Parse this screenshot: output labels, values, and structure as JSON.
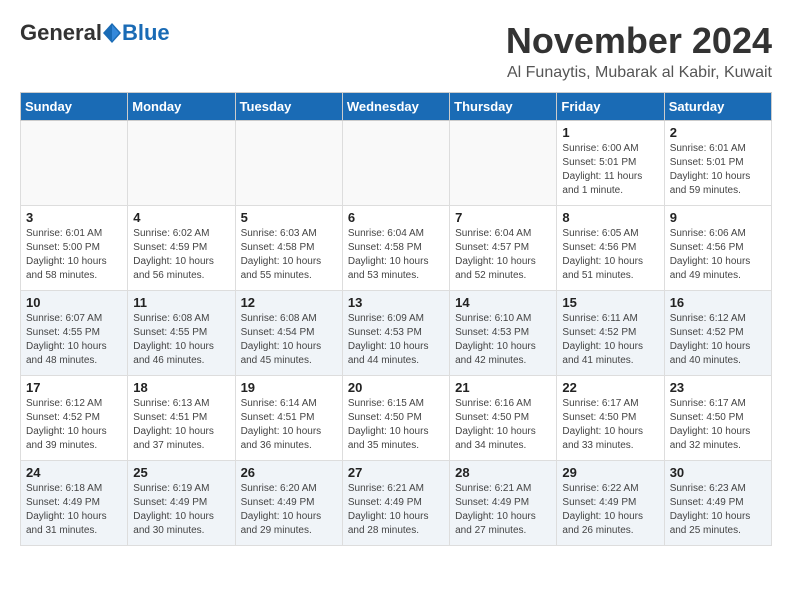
{
  "header": {
    "logo_general": "General",
    "logo_blue": "Blue",
    "month_title": "November 2024",
    "subtitle": "Al Funaytis, Mubarak al Kabir, Kuwait"
  },
  "weekdays": [
    "Sunday",
    "Monday",
    "Tuesday",
    "Wednesday",
    "Thursday",
    "Friday",
    "Saturday"
  ],
  "weeks": [
    [
      {
        "day": "",
        "info": ""
      },
      {
        "day": "",
        "info": ""
      },
      {
        "day": "",
        "info": ""
      },
      {
        "day": "",
        "info": ""
      },
      {
        "day": "",
        "info": ""
      },
      {
        "day": "1",
        "info": "Sunrise: 6:00 AM\nSunset: 5:01 PM\nDaylight: 11 hours\nand 1 minute."
      },
      {
        "day": "2",
        "info": "Sunrise: 6:01 AM\nSunset: 5:01 PM\nDaylight: 10 hours\nand 59 minutes."
      }
    ],
    [
      {
        "day": "3",
        "info": "Sunrise: 6:01 AM\nSunset: 5:00 PM\nDaylight: 10 hours\nand 58 minutes."
      },
      {
        "day": "4",
        "info": "Sunrise: 6:02 AM\nSunset: 4:59 PM\nDaylight: 10 hours\nand 56 minutes."
      },
      {
        "day": "5",
        "info": "Sunrise: 6:03 AM\nSunset: 4:58 PM\nDaylight: 10 hours\nand 55 minutes."
      },
      {
        "day": "6",
        "info": "Sunrise: 6:04 AM\nSunset: 4:58 PM\nDaylight: 10 hours\nand 53 minutes."
      },
      {
        "day": "7",
        "info": "Sunrise: 6:04 AM\nSunset: 4:57 PM\nDaylight: 10 hours\nand 52 minutes."
      },
      {
        "day": "8",
        "info": "Sunrise: 6:05 AM\nSunset: 4:56 PM\nDaylight: 10 hours\nand 51 minutes."
      },
      {
        "day": "9",
        "info": "Sunrise: 6:06 AM\nSunset: 4:56 PM\nDaylight: 10 hours\nand 49 minutes."
      }
    ],
    [
      {
        "day": "10",
        "info": "Sunrise: 6:07 AM\nSunset: 4:55 PM\nDaylight: 10 hours\nand 48 minutes."
      },
      {
        "day": "11",
        "info": "Sunrise: 6:08 AM\nSunset: 4:55 PM\nDaylight: 10 hours\nand 46 minutes."
      },
      {
        "day": "12",
        "info": "Sunrise: 6:08 AM\nSunset: 4:54 PM\nDaylight: 10 hours\nand 45 minutes."
      },
      {
        "day": "13",
        "info": "Sunrise: 6:09 AM\nSunset: 4:53 PM\nDaylight: 10 hours\nand 44 minutes."
      },
      {
        "day": "14",
        "info": "Sunrise: 6:10 AM\nSunset: 4:53 PM\nDaylight: 10 hours\nand 42 minutes."
      },
      {
        "day": "15",
        "info": "Sunrise: 6:11 AM\nSunset: 4:52 PM\nDaylight: 10 hours\nand 41 minutes."
      },
      {
        "day": "16",
        "info": "Sunrise: 6:12 AM\nSunset: 4:52 PM\nDaylight: 10 hours\nand 40 minutes."
      }
    ],
    [
      {
        "day": "17",
        "info": "Sunrise: 6:12 AM\nSunset: 4:52 PM\nDaylight: 10 hours\nand 39 minutes."
      },
      {
        "day": "18",
        "info": "Sunrise: 6:13 AM\nSunset: 4:51 PM\nDaylight: 10 hours\nand 37 minutes."
      },
      {
        "day": "19",
        "info": "Sunrise: 6:14 AM\nSunset: 4:51 PM\nDaylight: 10 hours\nand 36 minutes."
      },
      {
        "day": "20",
        "info": "Sunrise: 6:15 AM\nSunset: 4:50 PM\nDaylight: 10 hours\nand 35 minutes."
      },
      {
        "day": "21",
        "info": "Sunrise: 6:16 AM\nSunset: 4:50 PM\nDaylight: 10 hours\nand 34 minutes."
      },
      {
        "day": "22",
        "info": "Sunrise: 6:17 AM\nSunset: 4:50 PM\nDaylight: 10 hours\nand 33 minutes."
      },
      {
        "day": "23",
        "info": "Sunrise: 6:17 AM\nSunset: 4:50 PM\nDaylight: 10 hours\nand 32 minutes."
      }
    ],
    [
      {
        "day": "24",
        "info": "Sunrise: 6:18 AM\nSunset: 4:49 PM\nDaylight: 10 hours\nand 31 minutes."
      },
      {
        "day": "25",
        "info": "Sunrise: 6:19 AM\nSunset: 4:49 PM\nDaylight: 10 hours\nand 30 minutes."
      },
      {
        "day": "26",
        "info": "Sunrise: 6:20 AM\nSunset: 4:49 PM\nDaylight: 10 hours\nand 29 minutes."
      },
      {
        "day": "27",
        "info": "Sunrise: 6:21 AM\nSunset: 4:49 PM\nDaylight: 10 hours\nand 28 minutes."
      },
      {
        "day": "28",
        "info": "Sunrise: 6:21 AM\nSunset: 4:49 PM\nDaylight: 10 hours\nand 27 minutes."
      },
      {
        "day": "29",
        "info": "Sunrise: 6:22 AM\nSunset: 4:49 PM\nDaylight: 10 hours\nand 26 minutes."
      },
      {
        "day": "30",
        "info": "Sunrise: 6:23 AM\nSunset: 4:49 PM\nDaylight: 10 hours\nand 25 minutes."
      }
    ]
  ]
}
